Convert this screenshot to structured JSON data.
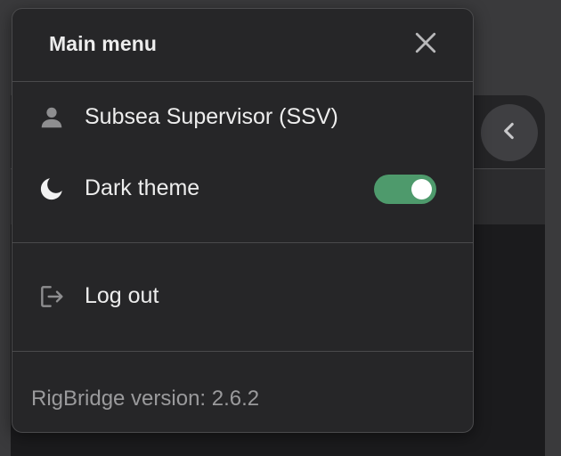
{
  "menu": {
    "title": "Main menu",
    "close_icon": "close-icon",
    "user": {
      "icon": "person-icon",
      "label": "Subsea Supervisor (SSV)"
    },
    "theme": {
      "icon": "moon-icon",
      "label": "Dark theme",
      "enabled": true,
      "toggle_color": "#4e9a6c"
    },
    "logout": {
      "icon": "logout-icon",
      "label": "Log out"
    },
    "version_text": "RigBridge version: 2.6.2"
  },
  "background_panel": {
    "collapse_icon": "chevron-left-icon"
  }
}
